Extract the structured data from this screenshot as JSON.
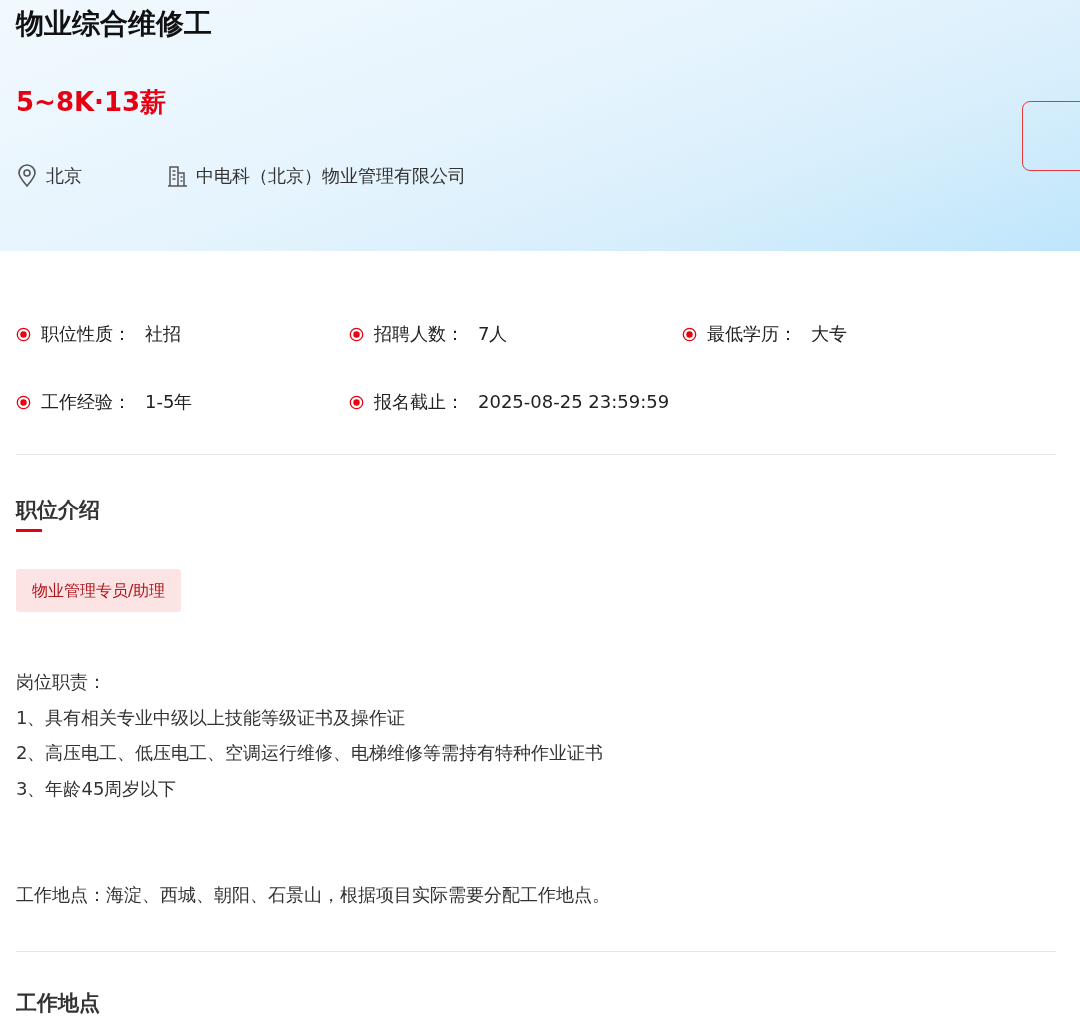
{
  "header": {
    "title": "物业综合维修工",
    "salary": "5~8K·13薪",
    "city": "北京",
    "company": "中电科（北京）物业管理有限公司"
  },
  "attributes": [
    {
      "label": "职位性质：",
      "value": "社招"
    },
    {
      "label": "招聘人数：",
      "value": "7人"
    },
    {
      "label": "最低学历：",
      "value": "大专"
    },
    {
      "label": "工作经验：",
      "value": "1-5年"
    },
    {
      "label": "报名截止：",
      "value": "2025-08-25 23:59:59"
    }
  ],
  "intro": {
    "heading": "职位介绍",
    "tag": "物业管理专员/助理",
    "description": [
      "岗位职责：",
      "1、具有相关专业中级以上技能等级证书及操作证",
      "2、高压电工、低压电工、空调运行维修、电梯维修等需持有特种作业证书",
      "3、年龄45周岁以下"
    ],
    "location_note": "工作地点：海淀、西城、朝阳、石景山，根据项目实际需要分配工作地点。"
  },
  "location_section": {
    "heading": "工作地点"
  }
}
